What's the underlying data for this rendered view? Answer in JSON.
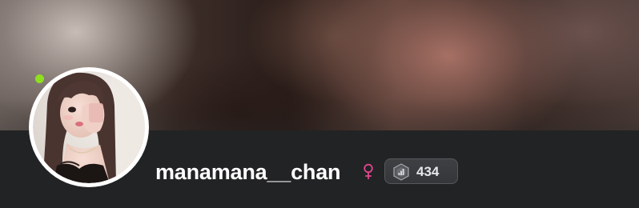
{
  "profile": {
    "username": "manamana__chan",
    "online": true,
    "status_color": "#8ee01e",
    "gender": "female",
    "gender_icon": "female-symbol-icon",
    "gender_color": "#e0478f",
    "avatar_alt": "manamana__chan avatar",
    "level_badge": {
      "icon": "hexagon-level-icon",
      "count": "434"
    }
  }
}
